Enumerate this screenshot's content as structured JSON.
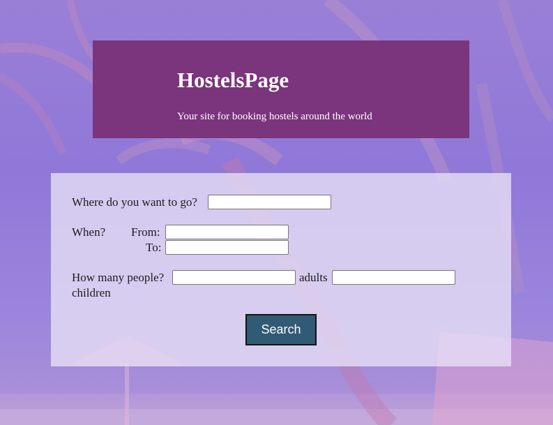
{
  "header": {
    "title": "HostelsPage",
    "tagline": "Your site for booking hostels around the world"
  },
  "form": {
    "destination_label": "Where do you want to go?",
    "destination_value": "",
    "when_label": "When?",
    "from_label": "From:",
    "from_value": "",
    "to_label": "To:",
    "to_value": "",
    "people_label": "How many people?",
    "adults_value": "",
    "adults_label": "adults",
    "children_value": "",
    "children_label": "children",
    "search_label": "Search"
  },
  "colors": {
    "header_bg": "#7a357c",
    "button_bg": "#315a74",
    "page_tint": "#8f78d8"
  }
}
